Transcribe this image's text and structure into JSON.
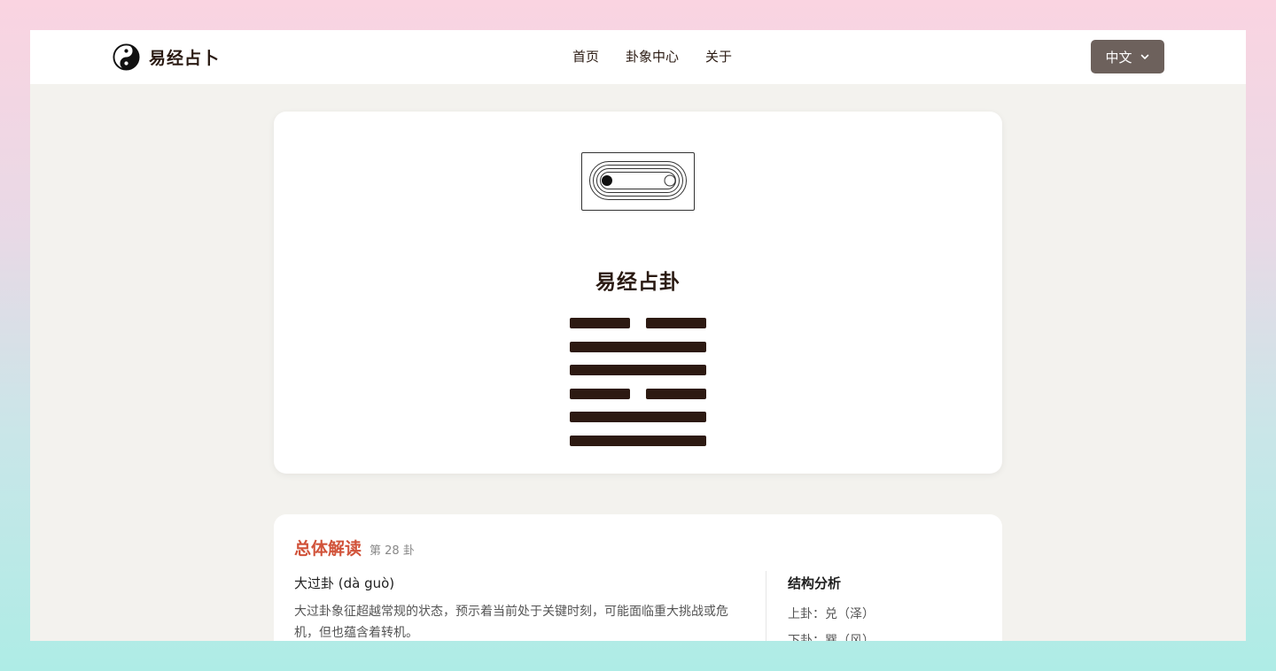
{
  "brand": {
    "name": "易经占卜",
    "logo_icon": "yin-yang-icon"
  },
  "nav": [
    "首页",
    "卦象中心",
    "关于"
  ],
  "language": {
    "label": "中文",
    "icon": "chevron-down-icon"
  },
  "main_card": {
    "coin_icon": "coin-tile-icon",
    "title": "易经占卦",
    "hexagram_lines": [
      "yin",
      "yang",
      "yang",
      "yin",
      "yang",
      "yang"
    ]
  },
  "interpretation": {
    "title": "总体解读",
    "number": "第 28 卦",
    "gua_name": "大过卦 (dà guò)",
    "description": "大过卦象征超越常规的状态，预示着当前处于关键时刻，可能面临重大挑战或危机，但也蕴含着转机。",
    "structure": {
      "title": "结构分析",
      "upper": "上卦：兑（泽）",
      "lower": "下卦：巽（风）"
    }
  },
  "colors": {
    "accent": "#d1533a",
    "ink": "#2d1a12",
    "lang_button": "#6d615c",
    "page_bg": "#f3f2ee"
  }
}
